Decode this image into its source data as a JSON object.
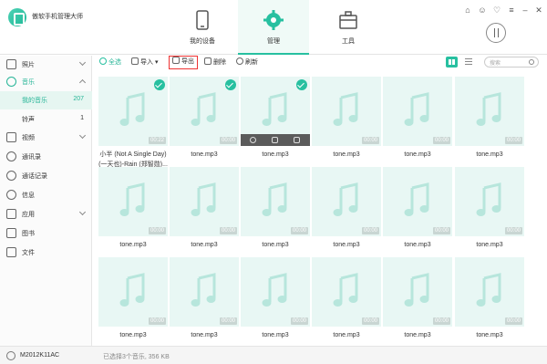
{
  "app": {
    "title": "傲软手机管理大师"
  },
  "nav": [
    {
      "label": "我的设备",
      "icon": "phone-icon"
    },
    {
      "label": "管理",
      "icon": "gear-icon",
      "active": true
    },
    {
      "label": "工具",
      "icon": "toolbox-icon"
    }
  ],
  "sidebar": {
    "items": [
      {
        "label": "照片",
        "icon": "photo-icon"
      },
      {
        "label": "音乐",
        "icon": "music-icon",
        "expanded": true
      },
      {
        "label": "视频",
        "icon": "video-icon"
      },
      {
        "label": "通讯录",
        "icon": "contacts-icon"
      },
      {
        "label": "通话记录",
        "icon": "call-log-icon"
      },
      {
        "label": "信息",
        "icon": "message-icon"
      },
      {
        "label": "应用",
        "icon": "apps-icon"
      },
      {
        "label": "图书",
        "icon": "book-icon"
      },
      {
        "label": "文件",
        "icon": "file-icon"
      }
    ],
    "music_sub": [
      {
        "label": "我的音乐",
        "count": "207",
        "active": true
      },
      {
        "label": "铃声",
        "count": "1"
      }
    ]
  },
  "toolbar": {
    "select_all": "全选",
    "import": "导入",
    "export": "导出",
    "delete": "删除",
    "refresh": "刷新",
    "search_placeholder": "搜索"
  },
  "tiles": [
    {
      "name_line1": "小半 (Not A Single Day)",
      "name_line2": "(一天也)-Rain (郑智勋)...",
      "duration": "00:22",
      "checked": true
    },
    {
      "name_line1": "tone.mp3",
      "duration": "00:00",
      "checked": true
    },
    {
      "name_line1": "tone.mp3",
      "duration": "",
      "checked": true,
      "hovered": true
    },
    {
      "name_line1": "tone.mp3",
      "duration": "00:00"
    },
    {
      "name_line1": "tone.mp3",
      "duration": "00:00"
    },
    {
      "name_line1": "tone.mp3",
      "duration": "00:00"
    },
    {
      "name_line1": "tone.mp3",
      "duration": "00:00"
    },
    {
      "name_line1": "tone.mp3",
      "duration": "00:00"
    },
    {
      "name_line1": "tone.mp3",
      "duration": "00:00"
    },
    {
      "name_line1": "tone.mp3",
      "duration": "00:00"
    },
    {
      "name_line1": "tone.mp3",
      "duration": "00:00"
    },
    {
      "name_line1": "tone.mp3",
      "duration": "00:00"
    },
    {
      "name_line1": "tone.mp3",
      "duration": "00:00"
    },
    {
      "name_line1": "tone.mp3",
      "duration": "00:00"
    },
    {
      "name_line1": "tone.mp3",
      "duration": "00:00"
    },
    {
      "name_line1": "tone.mp3",
      "duration": "00:00"
    },
    {
      "name_line1": "tone.mp3",
      "duration": "00:00"
    },
    {
      "name_line1": "tone.mp3",
      "duration": "00:00"
    }
  ],
  "status": {
    "device": "M2012K11AC",
    "selection": "已选择3个音乐, 356 KB"
  },
  "colors": {
    "accent": "#27c0a0",
    "thumb_bg": "#e8f7f4",
    "export_highlight": "#e33333"
  }
}
